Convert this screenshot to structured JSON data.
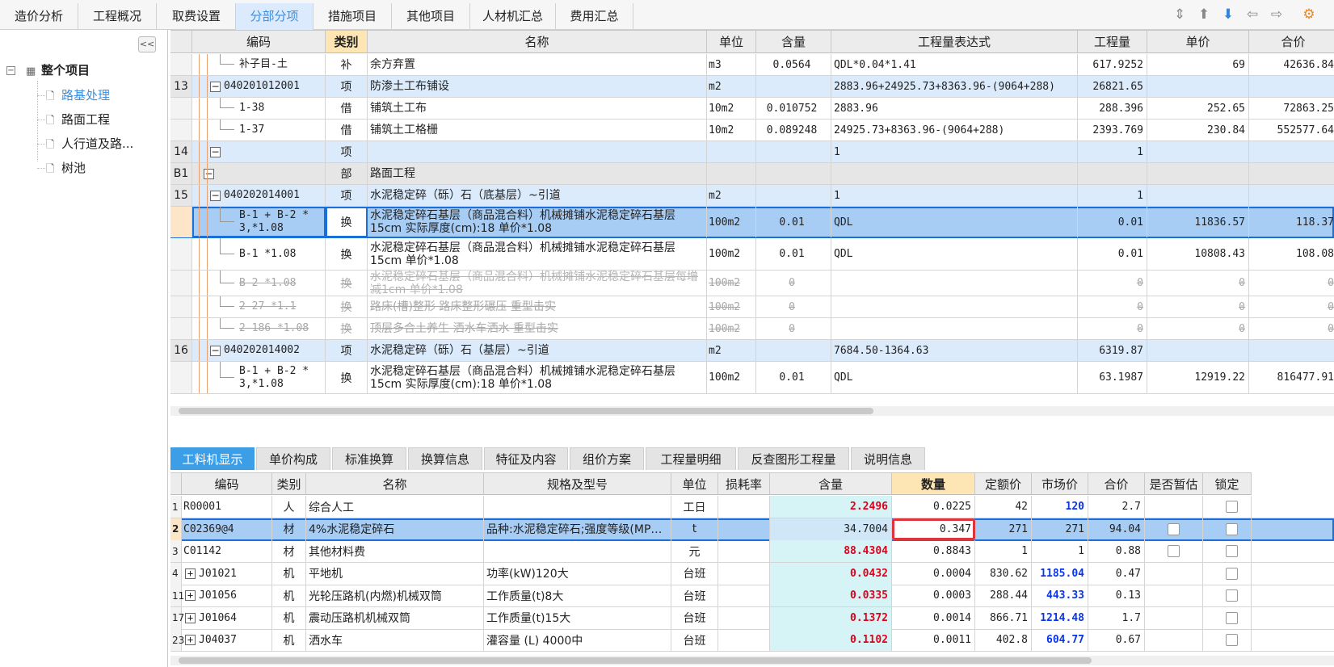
{
  "top_tabs": [
    "造价分析",
    "工程概况",
    "取费设置",
    "分部分项",
    "措施项目",
    "其他项目",
    "人材机汇总",
    "费用汇总"
  ],
  "active_top_tab": "分部分项",
  "toolbar_icons": [
    "column-adjust-icon",
    "move-up-icon",
    "move-down-icon",
    "arrow-left-icon",
    "arrow-right-icon",
    "settings-icon"
  ],
  "sidebar": {
    "collapse_label": "<<",
    "root": "整个项目",
    "items": [
      {
        "label": "路基处理",
        "selected": true
      },
      {
        "label": "路面工程"
      },
      {
        "label": "人行道及路..."
      },
      {
        "label": "树池"
      }
    ]
  },
  "upper_table": {
    "headers": [
      "编码",
      "类别",
      "名称",
      "单位",
      "含量",
      "工程量表达式",
      "工程量",
      "单价",
      "合价"
    ],
    "rows": [
      {
        "idx": "",
        "code": "补子目-土",
        "type": "补",
        "name": "余方弃置",
        "unit": "m3",
        "qty": "0.0564",
        "expr": "QDL*0.04*1.41",
        "amount": "617.9252",
        "price": "69",
        "total": "42636.84",
        "style": "sub"
      },
      {
        "idx": "13",
        "code": "040201012001",
        "type": "项",
        "name": "防渗土工布铺设",
        "unit": "m2",
        "qty": "",
        "expr": "2883.96+24925.73+8363.96-(9064+288)",
        "amount": "26821.65",
        "price": "",
        "total": "",
        "style": "item"
      },
      {
        "idx": "",
        "code": "1-38",
        "type": "借",
        "name": "铺筑土工布",
        "unit": "10m2",
        "qty": "0.010752",
        "expr": "2883.96",
        "amount": "288.396",
        "price": "252.65",
        "total": "72863.25",
        "style": "sub"
      },
      {
        "idx": "",
        "code": "1-37",
        "type": "借",
        "name": "铺筑土工格栅",
        "unit": "10m2",
        "qty": "0.089248",
        "expr": "24925.73+8363.96-(9064+288)",
        "amount": "2393.769",
        "price": "230.84",
        "total": "552577.64",
        "style": "sub"
      },
      {
        "idx": "14",
        "code": "",
        "type": "项",
        "name": "",
        "unit": "",
        "qty": "",
        "expr": "1",
        "amount": "1",
        "price": "",
        "total": "",
        "style": "item"
      },
      {
        "idx": "B1",
        "code": "",
        "type": "部",
        "name": "路面工程",
        "unit": "",
        "qty": "",
        "expr": "",
        "amount": "",
        "price": "",
        "total": "",
        "style": "part"
      },
      {
        "idx": "15",
        "code": "040202014001",
        "type": "项",
        "name": "水泥稳定碎（砾）石（底基层）~引道",
        "unit": "m2",
        "qty": "",
        "expr": "1",
        "amount": "1",
        "price": "",
        "total": "",
        "style": "item"
      },
      {
        "idx": "",
        "code": "B-1 + B-2 * 3,*1.08",
        "type": "换",
        "name": "水泥稳定碎石基层（商品混合料）机械摊铺水泥稳定碎石基层15cm  实际厚度(cm):18  单价*1.08",
        "unit": "100m2",
        "qty": "0.01",
        "expr": "QDL",
        "amount": "0.01",
        "price": "11836.57",
        "total": "118.37",
        "style": "selected"
      },
      {
        "idx": "",
        "code": "B-1 *1.08",
        "type": "换",
        "name": "水泥稳定碎石基层（商品混合料）机械摊铺水泥稳定碎石基层15cm  单价*1.08",
        "unit": "100m2",
        "qty": "0.01",
        "expr": "QDL",
        "amount": "0.01",
        "price": "10808.43",
        "total": "108.08",
        "style": "sub2"
      },
      {
        "idx": "",
        "code": "B-2 *1.08",
        "type": "换",
        "name": "水泥稳定碎石基层（商品混合料）机械摊铺水泥稳定碎石基层每增减1cm  单价*1.08",
        "unit": "100m2",
        "qty": "0",
        "expr": "",
        "amount": "0",
        "price": "0",
        "total": "0",
        "style": "strike2"
      },
      {
        "idx": "",
        "code": "2-27 *1.1",
        "type": "换",
        "name": "路床(槽)整形 路床整形碾压  重型击实",
        "unit": "100m2",
        "qty": "0",
        "expr": "",
        "amount": "0",
        "price": "0",
        "total": "0",
        "style": "strike"
      },
      {
        "idx": "",
        "code": "2-186 *1.08",
        "type": "换",
        "name": "顶层多合土养生 洒水车洒水  重型击实",
        "unit": "100m2",
        "qty": "0",
        "expr": "",
        "amount": "0",
        "price": "0",
        "total": "0",
        "style": "strike"
      },
      {
        "idx": "16",
        "code": "040202014002",
        "type": "项",
        "name": "水泥稳定碎（砾）石（基层）~引道",
        "unit": "m2",
        "qty": "",
        "expr": "7684.50-1364.63",
        "amount": "6319.87",
        "price": "",
        "total": "",
        "style": "item"
      },
      {
        "idx": "",
        "code": "B-1 + B-2 * 3,*1.08",
        "type": "换",
        "name": "水泥稳定碎石基层（商品混合料）机械摊铺水泥稳定碎石基层15cm  实际厚度(cm):18  单价*1.08",
        "unit": "100m2",
        "qty": "0.01",
        "expr": "QDL",
        "amount": "63.1987",
        "price": "12919.22",
        "total": "816477.91",
        "style": "sub2"
      }
    ]
  },
  "bottom_tabs": [
    "工料机显示",
    "单价构成",
    "标准换算",
    "换算信息",
    "特征及内容",
    "组价方案",
    "工程量明细",
    "反查图形工程量",
    "说明信息"
  ],
  "active_bottom_tab": "工料机显示",
  "lower_table": {
    "headers": [
      "",
      "编码",
      "类别",
      "名称",
      "规格及型号",
      "单位",
      "损耗率",
      "含量",
      "数量",
      "定额价",
      "市场价",
      "合价",
      "是否暂估",
      "锁定"
    ],
    "rows": [
      {
        "idx": "1",
        "exp": false,
        "code": "R00001",
        "type": "人",
        "name": "综合人工",
        "spec": "",
        "unit": "工日",
        "loss": "",
        "content": "2.2496",
        "qty": "0.0225",
        "base": "42",
        "market": "120",
        "total": "2.7",
        "est": false,
        "marketBlue": true
      },
      {
        "idx": "2",
        "exp": false,
        "code": "C02369@4",
        "type": "材",
        "name": "4%水泥稳定碎石",
        "spec": "品种:水泥稳定碎石;强度等级(MP…",
        "unit": "t",
        "loss": "",
        "content": "34.7004",
        "qty": "0.347",
        "base": "271",
        "market": "271",
        "total": "94.04",
        "est": true,
        "marketBlue": false,
        "selected": true
      },
      {
        "idx": "3",
        "exp": false,
        "code": "C01142",
        "type": "材",
        "name": "其他材料费",
        "spec": "",
        "unit": "元",
        "loss": "",
        "content": "88.4304",
        "qty": "0.8843",
        "base": "1",
        "market": "1",
        "total": "0.88",
        "est": true,
        "marketBlue": false
      },
      {
        "idx": "4",
        "exp": true,
        "code": "J01021",
        "type": "机",
        "name": "平地机",
        "spec": "功率(kW)120大",
        "unit": "台班",
        "loss": "",
        "content": "0.0432",
        "qty": "0.0004",
        "base": "830.62",
        "market": "1185.04",
        "total": "0.47",
        "est": false,
        "marketBlue": true
      },
      {
        "idx": "11",
        "exp": true,
        "code": "J01056",
        "type": "机",
        "name": "光轮压路机(内燃)机械双筒",
        "spec": "工作质量(t)8大",
        "unit": "台班",
        "loss": "",
        "content": "0.0335",
        "qty": "0.0003",
        "base": "288.44",
        "market": "443.33",
        "total": "0.13",
        "est": false,
        "marketBlue": true
      },
      {
        "idx": "17",
        "exp": true,
        "code": "J01064",
        "type": "机",
        "name": "震动压路机机械双筒",
        "spec": "工作质量(t)15大",
        "unit": "台班",
        "loss": "",
        "content": "0.1372",
        "qty": "0.0014",
        "base": "866.71",
        "market": "1214.48",
        "total": "1.7",
        "est": false,
        "marketBlue": true
      },
      {
        "idx": "23",
        "exp": true,
        "code": "J04037",
        "type": "机",
        "name": "洒水车",
        "spec": "灌容量 (L) 4000中",
        "unit": "台班",
        "loss": "",
        "content": "0.1102",
        "qty": "0.0011",
        "base": "402.8",
        "market": "604.77",
        "total": "0.67",
        "est": false,
        "marketBlue": true
      }
    ]
  },
  "colors": {
    "accent": "#3d9ee8",
    "selected_row": "#a8cdf5",
    "item_row": "#dcebfc",
    "part_row": "#e6e6e6",
    "highlight_box": "#e0343c",
    "content_col": "#d6f4f6",
    "red_text": "#e0001a",
    "blue_text": "#0a35e8"
  }
}
